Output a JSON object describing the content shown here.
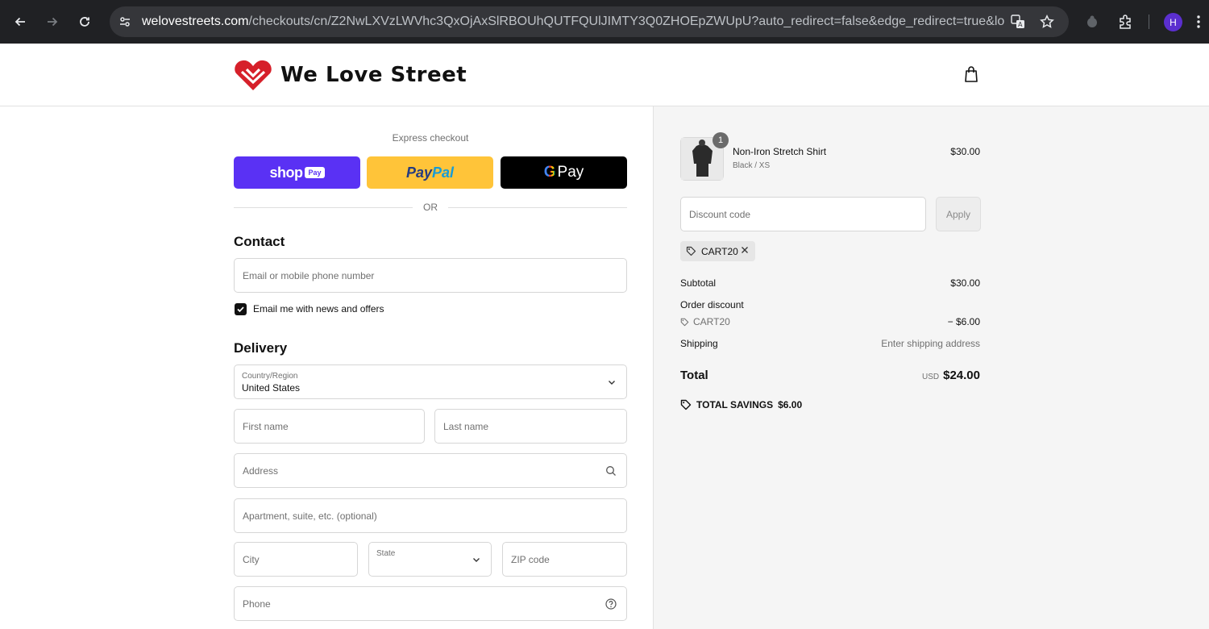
{
  "browser": {
    "url_host": "welovestreets.com",
    "url_rest": "/checkouts/cn/Z2NwLXVzLWVhc3QxOjAxSlRBOUhQUTFQUlJIMTY3Q0ZHOEpZWUpU?auto_redirect=false&edge_redirect=true&locale...",
    "profile_initial": "H"
  },
  "store": {
    "name": "We Love Street",
    "brand_color": "#d6202a"
  },
  "express": {
    "label": "Express checkout",
    "shop_pay_text": "shop",
    "shop_pay_pill": "Pay",
    "paypal_part1": "Pay",
    "paypal_part2": "Pal",
    "gpay_g": "G",
    "gpay_text": "Pay",
    "or_label": "OR"
  },
  "contact": {
    "title": "Contact",
    "email_placeholder": "Email or mobile phone number",
    "newsletter_label": "Email me with news and offers",
    "newsletter_checked": true
  },
  "delivery": {
    "title": "Delivery",
    "country_label": "Country/Region",
    "country_value": "United States",
    "first_name_placeholder": "First name",
    "last_name_placeholder": "Last name",
    "address_placeholder": "Address",
    "apartment_placeholder": "Apartment, suite, etc. (optional)",
    "city_placeholder": "City",
    "state_label": "State",
    "zip_placeholder": "ZIP code",
    "phone_placeholder": "Phone"
  },
  "summary": {
    "item": {
      "name": "Non-Iron Stretch Shirt",
      "variant": "Black / XS",
      "price": "$30.00",
      "quantity": "1"
    },
    "discount_placeholder": "Discount code",
    "apply_label": "Apply",
    "applied_code": "CART20",
    "subtotal_label": "Subtotal",
    "subtotal_value": "$30.00",
    "order_discount_label": "Order discount",
    "order_discount_code": "CART20",
    "order_discount_value": "− $6.00",
    "shipping_label": "Shipping",
    "shipping_value": "Enter shipping address",
    "total_label": "Total",
    "total_currency": "USD",
    "total_value": "$24.00",
    "savings_label": "TOTAL SAVINGS",
    "savings_value": "$6.00"
  }
}
